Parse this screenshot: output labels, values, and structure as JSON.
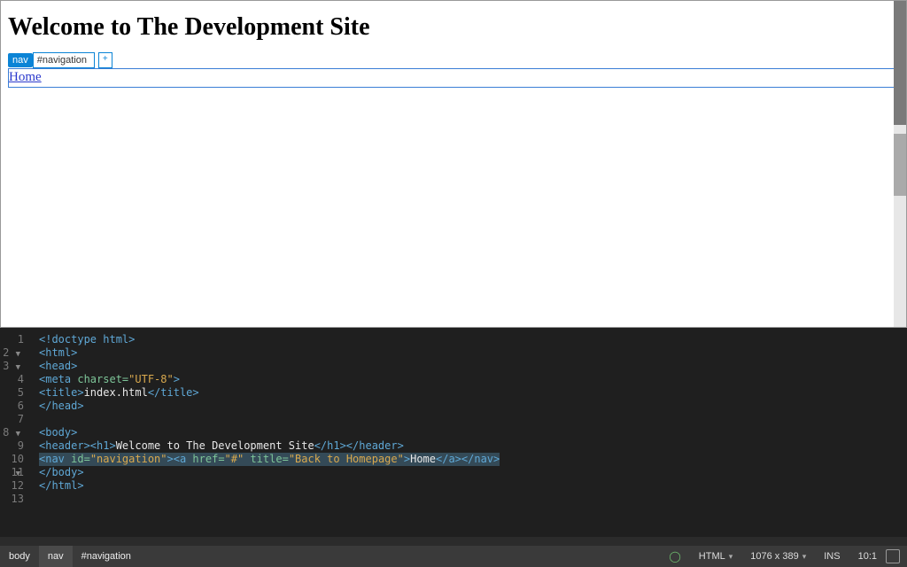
{
  "preview": {
    "heading": "Welcome to The Development Site",
    "nav_link_text": "Home",
    "inspector": {
      "element_tag": "nav",
      "element_id_value": "#navigation",
      "add_button_label": "+"
    }
  },
  "editor": {
    "lines": [
      {
        "n": "1",
        "fold": "",
        "html": "<span class='tagc'>&lt;!doctype html&gt;</span>"
      },
      {
        "n": "2",
        "fold": "▼",
        "html": "<span class='tagc'>&lt;html&gt;</span>"
      },
      {
        "n": "3",
        "fold": "▼",
        "html": "<span class='tagc'>&lt;head&gt;</span>"
      },
      {
        "n": "4",
        "fold": "",
        "html": "<span class='tagc'>&lt;meta </span><span class='attrn'>charset=</span><span class='str'>\"UTF-8\"</span><span class='tagc'>&gt;</span>"
      },
      {
        "n": "5",
        "fold": "",
        "html": "<span class='tagc'>&lt;title&gt;</span><span class='txt'>index.html</span><span class='tagc'>&lt;/title&gt;</span>"
      },
      {
        "n": "6",
        "fold": "",
        "html": "<span class='tagc'>&lt;/head&gt;</span>"
      },
      {
        "n": "7",
        "fold": "",
        "html": ""
      },
      {
        "n": "8",
        "fold": "▼",
        "html": "<span class='tagc'>&lt;body&gt;</span>"
      },
      {
        "n": "9",
        "fold": "",
        "html": "<span class='tagc'>&lt;header&gt;&lt;h1&gt;</span><span class='txt'>Welcome to The Development Site</span><span class='tagc'>&lt;/h1&gt;&lt;/header&gt;</span>"
      },
      {
        "n": "10",
        "fold": "▼",
        "html": "<span class='sel-line'><span class='tagc'>&lt;nav </span><span class='attrn'>id=</span><span class='str'>\"navigation\"</span><span class='tagc'>&gt;&lt;a </span><span class='attrn'>href=</span><span class='str'>\"#\"</span><span class='attrn'> title=</span><span class='str'>\"Back to Homepage\"</span><span class='tagc'>&gt;</span><span class='txt'>Home</span><span class='tagc'>&lt;/a&gt;&lt;/nav&gt;</span></span>"
      },
      {
        "n": "11",
        "fold": "",
        "html": "<span class='tagc'>&lt;/body&gt;</span>"
      },
      {
        "n": "12",
        "fold": "",
        "html": "<span class='tagc'>&lt;/html&gt;</span>"
      },
      {
        "n": "13",
        "fold": "",
        "html": ""
      }
    ]
  },
  "statusbar": {
    "breadcrumbs": [
      "body",
      "nav",
      "#navigation"
    ],
    "language": "HTML",
    "viewport": "1076 x 389",
    "mode": "INS",
    "cursor": "10:1"
  }
}
